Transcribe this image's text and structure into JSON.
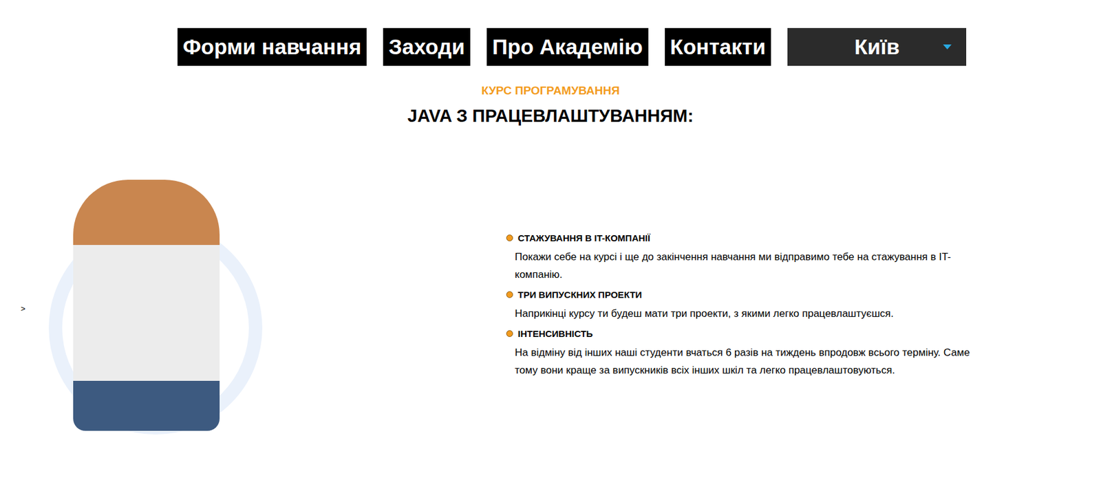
{
  "nav": {
    "items": [
      {
        "label": "Форми навчання"
      },
      {
        "label": "Заходи"
      },
      {
        "label": "Про Академію"
      },
      {
        "label": "Контакти"
      }
    ],
    "city": {
      "label": "Київ",
      "expanded": false
    }
  },
  "eyebrow": "КУРС ПРОГРАМУВАННЯ",
  "title": "JAVA З ПРАЦЕВЛАШТУВАННЯМ:",
  "slider": {
    "prev": ">"
  },
  "features": [
    {
      "title": "СТАЖУВАННЯ В IT-КОМПАНІЇ",
      "text": "Покажи себе на курсі і ще до закінчення навчання ми відправимо тебе на стажування в IT-компанію."
    },
    {
      "title": "ТРИ ВИПУСКНИХ ПРОЕКТИ",
      "text": "Наприкінці курсу ти будеш мати три проекти, з якими легко працевлаштуєшся."
    },
    {
      "title": "ІНТЕНСИВНІСТЬ",
      "text": "На відміну від інших наші студенти вчаться 6 разів на тиждень впродовж всього терміну. Саме тому вони краще за випускників всіх інших шкіл та легко працевлаштовуються."
    }
  ]
}
